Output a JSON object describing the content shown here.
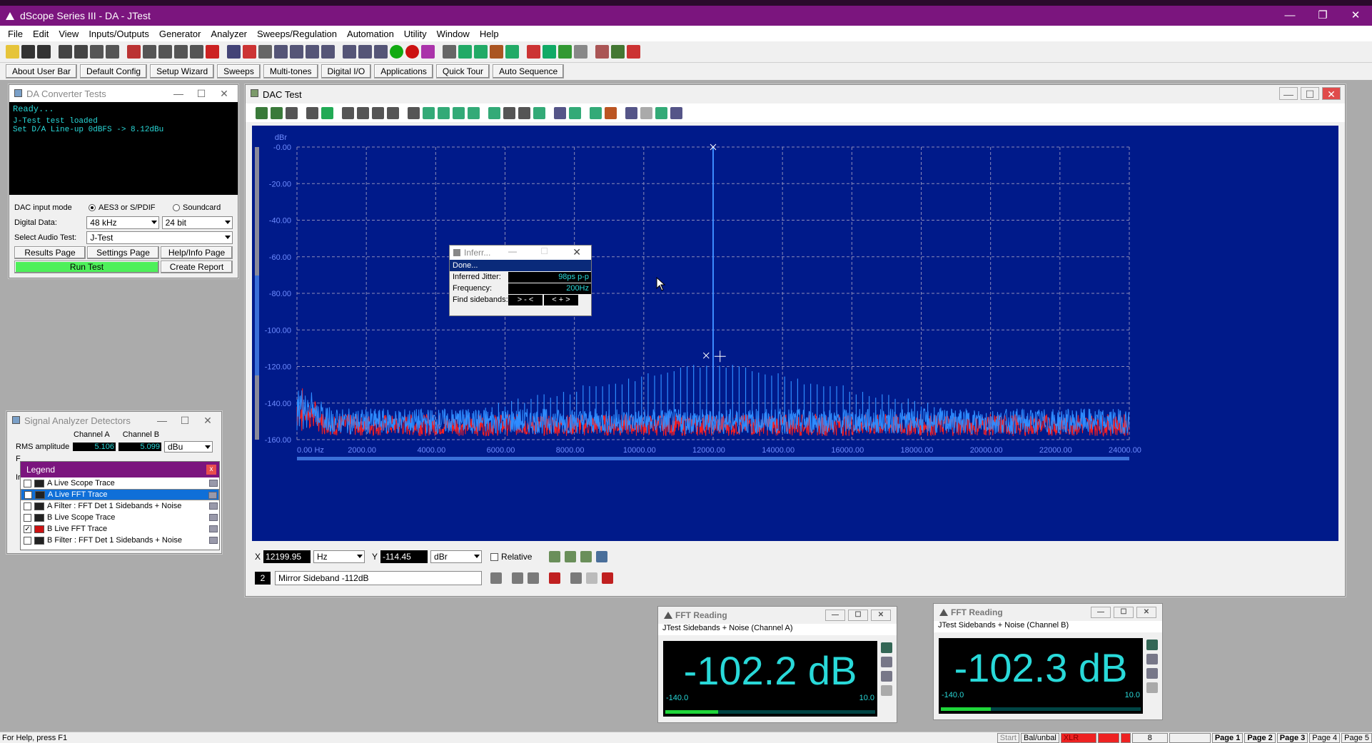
{
  "app": {
    "title": "dScope Series III - DA - JTest",
    "window_controls": [
      "—",
      "❐",
      "✕"
    ]
  },
  "menu": [
    "File",
    "Edit",
    "View",
    "Inputs/Outputs",
    "Generator",
    "Analyzer",
    "Sweeps/Regulation",
    "Automation",
    "Utility",
    "Window",
    "Help"
  ],
  "user_bar": [
    "About User Bar",
    "Default Config",
    "Setup Wizard",
    "Sweeps",
    "Multi-tones",
    "Digital I/O",
    "Applications",
    "Quick Tour",
    "Auto Sequence"
  ],
  "dac_panel": {
    "title": "DA Converter Tests",
    "console_lines": [
      "Ready...",
      "J-Test test loaded",
      "Set D/A Line-up 0dBFS -> 8.12dBu"
    ],
    "input_mode_label": "DAC input mode",
    "mode_options": [
      "AES3 or S/PDIF",
      "Soundcard"
    ],
    "digital_data_label": "Digital Data:",
    "sample_rate": "48 kHz",
    "bit_depth": "24 bit",
    "audio_test_label": "Select Audio Test:",
    "audio_test": "J-Test",
    "results_button": "Results Page",
    "settings_button": "Settings Page",
    "help_button": "Help/Info Page",
    "run_button": "Run Test",
    "report_button": "Create Report"
  },
  "detectors": {
    "title": "Signal Analyzer Detectors",
    "channel_a": "Channel A",
    "channel_b": "Channel B",
    "rms_label": "RMS amplitude",
    "rms_a": "5.106",
    "rms_b": "5.099",
    "unit": "dBu",
    "cut_labels": [
      "F",
      "Ir"
    ]
  },
  "legend": {
    "title": "Legend",
    "close": "x",
    "items": [
      {
        "label": "A  Live Scope Trace",
        "checked": false
      },
      {
        "label": "A  Live FFT Trace",
        "checked": true,
        "selected": true
      },
      {
        "label": "A  Filter : FFT Det 1 Sidebands + Noise",
        "checked": false
      },
      {
        "label": "B  Live Scope Trace",
        "checked": false
      },
      {
        "label": "B  Live FFT Trace",
        "checked": true
      },
      {
        "label": "B  Filter : FFT Det 1 Sidebands + Noise",
        "checked": false
      }
    ]
  },
  "dac_test": {
    "title": "DAC Test",
    "x_label": "X",
    "x_value": "12199.95",
    "x_unit": "Hz",
    "y_label": "Y",
    "y_value": "-114.45",
    "y_unit": "dBr",
    "relative_label": "Relative",
    "marker_number": "2",
    "marker_text": "Mirror Sideband -112dB"
  },
  "infer_dialog": {
    "title": "Inferr...",
    "status": "Done...",
    "jitter_label": "Inferred Jitter:",
    "jitter_value": "98ps p-p",
    "freq_label": "Frequency:",
    "freq_value": "200Hz",
    "sidebands_label": "Find sidebands:",
    "btn_left": "> - <",
    "btn_right": "< + >"
  },
  "chart_data": {
    "type": "line",
    "ylabel": "dBr",
    "ylim": [
      -160,
      0
    ],
    "xlim": [
      0,
      24000
    ],
    "y_ticks": [
      "-0.00",
      "-20.00",
      "-40.00",
      "-60.00",
      "-80.00",
      "-100.00",
      "-120.00",
      "-140.00",
      "-160.00"
    ],
    "x_ticks": [
      "0.00 Hz",
      "2000.00",
      "4000.00",
      "6000.00",
      "8000.00",
      "10000.00",
      "12000.00",
      "14000.00",
      "16000.00",
      "18000.00",
      "20000.00",
      "22000.00",
      "24000.00"
    ],
    "grid": true,
    "series": [
      {
        "color": "#2e8cff",
        "noise_floor": -150,
        "peak": {
          "x": 12000,
          "y": 0
        },
        "sidebands_center": 12000
      },
      {
        "color": "#ff2020",
        "noise_floor": -152
      }
    ],
    "markers": [
      {
        "x": 12000,
        "y": 0
      },
      {
        "x": 11800,
        "y": -114
      },
      {
        "x": 12199.95,
        "y": -114.45
      }
    ]
  },
  "fft_a": {
    "title": "FFT Reading",
    "subtitle": "JTest Sidebands + Noise  (Channel A)",
    "value": "-102.2 dB",
    "scale_min": "-140.0",
    "scale_max": "10.0",
    "level": 0.25
  },
  "fft_b": {
    "title": "FFT Reading",
    "subtitle": "JTest Sidebands + Noise (Channel B)",
    "value": "-102.3 dB",
    "scale_min": "-140.0",
    "scale_max": "10.0",
    "level": 0.25
  },
  "status": {
    "help": "For Help, press F1",
    "right": [
      "Start",
      "Bal/unbal",
      "XLR",
      "8",
      "Page 1",
      "Page 2",
      "Page 3",
      "Page 4",
      "Page 5"
    ]
  }
}
